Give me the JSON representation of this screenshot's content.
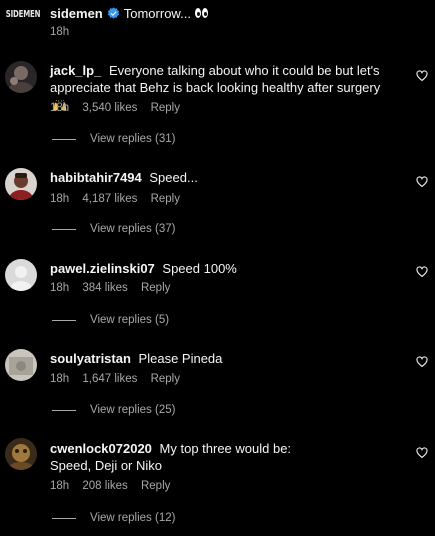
{
  "caption": {
    "username": "sidemen",
    "text": "Tomorrow...",
    "emoji_icon": "eyes-icon",
    "time": "18h",
    "logo_text": "SIDEMEN",
    "verified_color": "#3897f0"
  },
  "comments": [
    {
      "username": "jack_lp_",
      "text": "Everyone talking about who it could be but let's appreciate that Behz is back looking healthy after surgery",
      "emoji_icon": "raising-hands-icon",
      "time": "18h",
      "likes": "3,540 likes",
      "reply_label": "Reply",
      "view_replies": "View replies (31)",
      "avatar_color": "#6b5a55"
    },
    {
      "username": "habibtahir7494",
      "text": "Speed...",
      "time": "18h",
      "likes": "4,187 likes",
      "reply_label": "Reply",
      "view_replies": "View replies (37)",
      "avatar_color": "#8a6a5a"
    },
    {
      "username": "pawel.zielinski07",
      "text": "Speed 100%",
      "time": "18h",
      "likes": "384 likes",
      "reply_label": "Reply",
      "view_replies": "View replies (5)",
      "avatar_color": "#d8d8d8"
    },
    {
      "username": "soulyatristan",
      "text": "Please Pineda",
      "time": "18h",
      "likes": "1,647 likes",
      "reply_label": "Reply",
      "view_replies": "View replies (25)",
      "avatar_color": "#b9b5ac"
    },
    {
      "username": "cwenlock072020",
      "text": "My top three would be: Speed, Deji or Niko",
      "time": "18h",
      "likes": "208 likes",
      "reply_label": "Reply",
      "view_replies": "View replies (12)",
      "avatar_color": "#8a6b3a"
    }
  ],
  "icons": {
    "like": "heart-outline-icon",
    "verified": "verified-badge-icon"
  },
  "colors": {
    "background": "#000000",
    "primary_text": "#f5f5f5",
    "secondary_text": "#a8a8a8"
  }
}
